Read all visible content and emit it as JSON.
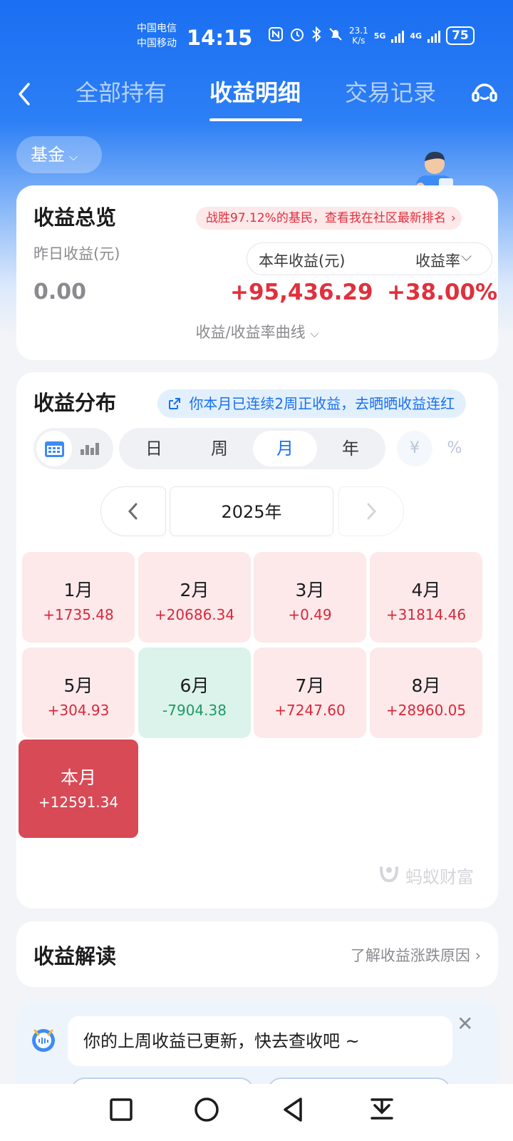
{
  "status_bar": {
    "carrier1": "中国电信",
    "carrier2": "中国移动",
    "time": "14:15",
    "speed_value": "23.1",
    "speed_unit": "K/s",
    "net1": "5G",
    "net2": "4G",
    "battery": "75"
  },
  "nav": {
    "tabs": [
      {
        "label": "全部持有"
      },
      {
        "label": "收益明细",
        "active": true
      },
      {
        "label": "交易记录"
      }
    ]
  },
  "filter": {
    "label": "基金"
  },
  "overview": {
    "title": "收益总览",
    "rank_text": "战胜97.12%的基民，查看我在社区最新排名",
    "yesterday_label": "昨日收益(元)",
    "yesterday_value": "0.00",
    "year_label": "本年收益(元)",
    "year_value": "+95,436.29",
    "rate_label": "收益率",
    "rate_value": "+38.00%",
    "curve_link": "收益/收益率曲线"
  },
  "distribution": {
    "title": "收益分布",
    "streak_text": "你本月已连续2周正收益，去晒晒收益连红",
    "periods": [
      "日",
      "周",
      "月",
      "年"
    ],
    "active_period": "月",
    "units": [
      "¥",
      "%"
    ],
    "year_label": "2025年",
    "months": [
      {
        "label": "1月",
        "value": "+1735.48",
        "state": "gain"
      },
      {
        "label": "2月",
        "value": "+20686.34",
        "state": "gain"
      },
      {
        "label": "3月",
        "value": "+0.49",
        "state": "gain"
      },
      {
        "label": "4月",
        "value": "+31814.46",
        "state": "gain"
      },
      {
        "label": "5月",
        "value": "+304.93",
        "state": "gain"
      },
      {
        "label": "6月",
        "value": "-7904.38",
        "state": "loss"
      },
      {
        "label": "7月",
        "value": "+7247.60",
        "state": "gain"
      },
      {
        "label": "8月",
        "value": "+28960.05",
        "state": "gain"
      },
      {
        "label": "本月",
        "value": "+12591.34",
        "state": "current"
      }
    ],
    "watermark": "蚂蚁财富"
  },
  "interpretation": {
    "title": "收益解读",
    "link": "了解收益涨跌原因"
  },
  "notice": {
    "text": "你的上周收益已更新，快去查收吧 ~"
  },
  "colors": {
    "brand_blue": "#1a6ff2",
    "gain_red": "#e0303d",
    "loss_green": "#1e9966"
  }
}
